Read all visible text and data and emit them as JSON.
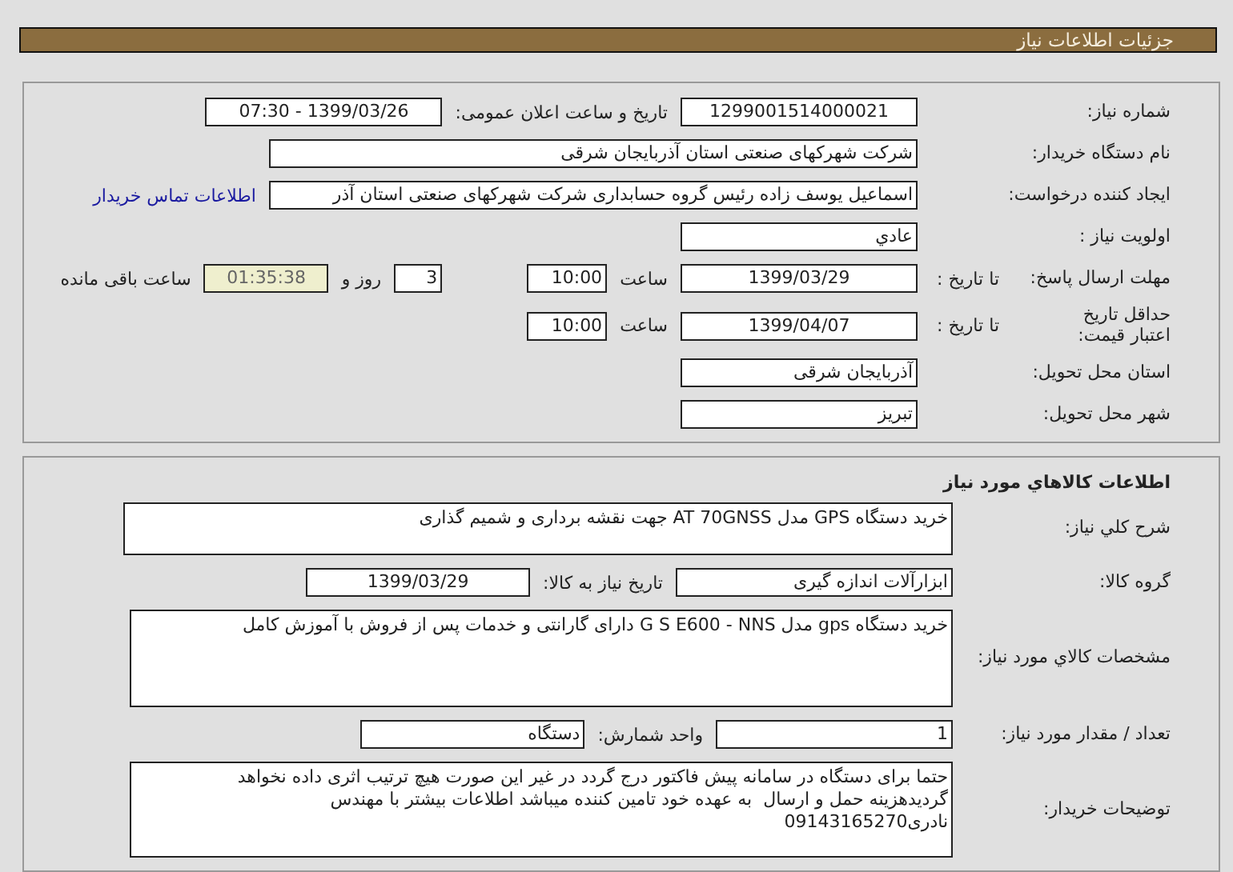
{
  "header": {
    "title": "جزئیات اطلاعات نیاز"
  },
  "need_info": {
    "rows": [
      {
        "label": "شماره نیاز:",
        "items": [
          {
            "kind": "field",
            "text": "1299001514000021",
            "centered": true
          },
          {
            "kind": "text",
            "text": "تاریخ و ساعت اعلان عمومی:"
          },
          {
            "kind": "field",
            "text": "1399/03/26 - 07:30",
            "centered": true
          }
        ]
      },
      {
        "label": "نام دستگاه خریدار:",
        "items": [
          {
            "kind": "wide-field",
            "text": "شرکت شهرکهای صنعتی استان آذربایجان شرقی"
          }
        ]
      },
      {
        "label": "ایجاد کننده درخواست:",
        "items": [
          {
            "kind": "wide-field",
            "text": "اسماعیل یوسف زاده رئیس گروه حسابداری شرکت شهرکهای صنعتی استان آذر"
          },
          {
            "kind": "link",
            "text": "اطلاعات تماس خریدار"
          }
        ]
      },
      {
        "label": "اولویت نیاز :",
        "items": [
          {
            "kind": "field",
            "text": "عادي"
          }
        ]
      },
      {
        "label": "مهلت ارسال پاسخ:",
        "sublabel": "تا تاریخ :",
        "items": [
          {
            "kind": "field",
            "text": "1399/03/29",
            "centered": true
          },
          {
            "kind": "text",
            "text": "ساعت"
          },
          {
            "kind": "time-field",
            "text": "10:00"
          },
          {
            "kind": "count-field",
            "text": "3"
          },
          {
            "kind": "text",
            "text": "روز و"
          },
          {
            "kind": "timer-field",
            "text": "01:35:38"
          },
          {
            "kind": "text",
            "text": "ساعت باقی مانده"
          }
        ]
      },
      {
        "label": "حداقل تاریخ اعتبار قیمت:",
        "sublabel": "تا تاریخ :",
        "items": [
          {
            "kind": "field",
            "text": "1399/04/07",
            "centered": true
          },
          {
            "kind": "text",
            "text": "ساعت"
          },
          {
            "kind": "time-field",
            "text": "10:00"
          }
        ]
      },
      {
        "label": "استان محل تحویل:",
        "items": [
          {
            "kind": "field",
            "text": "آذربایجان شرقی"
          }
        ]
      },
      {
        "label": "شهر محل تحویل:",
        "items": [
          {
            "kind": "field",
            "text": "تبریز"
          }
        ]
      }
    ]
  },
  "goods_info": {
    "title": "اطلاعات کالاهاي مورد نیاز",
    "rows": [
      {
        "label": "شرح کلي نیاز:",
        "items": [
          {
            "kind": "desc-field",
            "text": "خرید دستگاه GPS مدل AT 70GNSS جهت نقشه برداری و شمیم گذاری"
          }
        ]
      },
      {
        "label": "گروه کالا:",
        "items": [
          {
            "kind": "mid-field",
            "text": "ابزارآلات اندازه گیری"
          },
          {
            "kind": "text",
            "text": "تاریخ نیاز به کالا:"
          },
          {
            "kind": "date-field",
            "text": "1399/03/29",
            "centered": true
          }
        ]
      },
      {
        "label": "مشخصات کالاي مورد نیاز:",
        "items": [
          {
            "kind": "spec-field",
            "text": "خرید دستگاه gps مدل G S E600 - NNS دارای گارانتی و خدمات پس از فروش با آموزش کامل"
          }
        ]
      },
      {
        "label": "تعداد / مقدار مورد نیاز:",
        "items": [
          {
            "kind": "field",
            "text": "1"
          },
          {
            "kind": "text",
            "text": "واحد شمارش:"
          },
          {
            "kind": "date-field",
            "text": "دستگاه"
          }
        ]
      },
      {
        "label": "توضیحات خریدار:",
        "items": [
          {
            "kind": "notes-field",
            "text": "حتما برای دستگاه در سامانه پیش فاکتور درج گردد در غیر این صورت هیچ ترتیب اثری داده نخواهد\nگردیدهزینه حمل و ارسال  به عهده خود تامین کننده میباشد اطلاعات بیشتر با مهندس\nنادری09143165270"
          }
        ]
      }
    ]
  }
}
